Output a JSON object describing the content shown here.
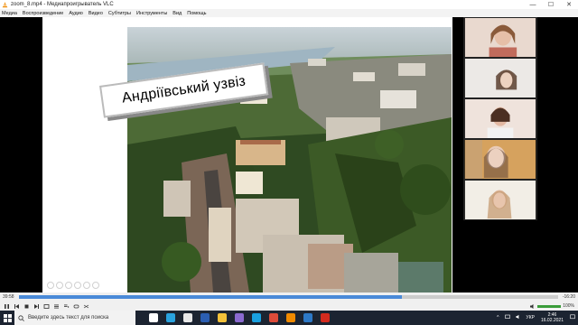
{
  "window": {
    "title": "zoom_8.mp4 - Медиапроигрыватель VLC",
    "min_symbol": "—",
    "max_symbol": "☐",
    "close_symbol": "✕"
  },
  "menu": [
    "Медиа",
    "Воспроизведение",
    "Аудио",
    "Видео",
    "Субтитры",
    "Инструменты",
    "Вид",
    "Помощь"
  ],
  "slide": {
    "title": "Андріївський узвіз"
  },
  "participants": [
    "participant-1",
    "participant-2",
    "participant-3",
    "participant-4",
    "participant-5"
  ],
  "player": {
    "elapsed": "39:58",
    "remaining": "-16:20",
    "progress": 0.71,
    "volume": "100%",
    "volume_level": 1.0
  },
  "taskbar": {
    "search_placeholder": "Введите здесь текст для поиска",
    "pinned_icons": [
      {
        "name": "task-view-icon",
        "color": "#ffffff"
      },
      {
        "name": "telegram-icon",
        "color": "#2aa3df"
      },
      {
        "name": "store-icon",
        "color": "#e8e8e8"
      },
      {
        "name": "word-icon",
        "color": "#2b5eb2"
      },
      {
        "name": "explorer-icon",
        "color": "#f3c13a"
      },
      {
        "name": "photos-icon",
        "color": "#8a6ad0"
      },
      {
        "name": "skype-icon",
        "color": "#19a0e0"
      },
      {
        "name": "chrome-icon",
        "color": "#dd4b39"
      },
      {
        "name": "vlc-icon",
        "color": "#f08a00"
      },
      {
        "name": "mail-icon",
        "color": "#2d79c7"
      },
      {
        "name": "pdf-icon",
        "color": "#d42b1e"
      }
    ],
    "language": "УКР",
    "time": "2:46",
    "date": "16.02.2021"
  }
}
